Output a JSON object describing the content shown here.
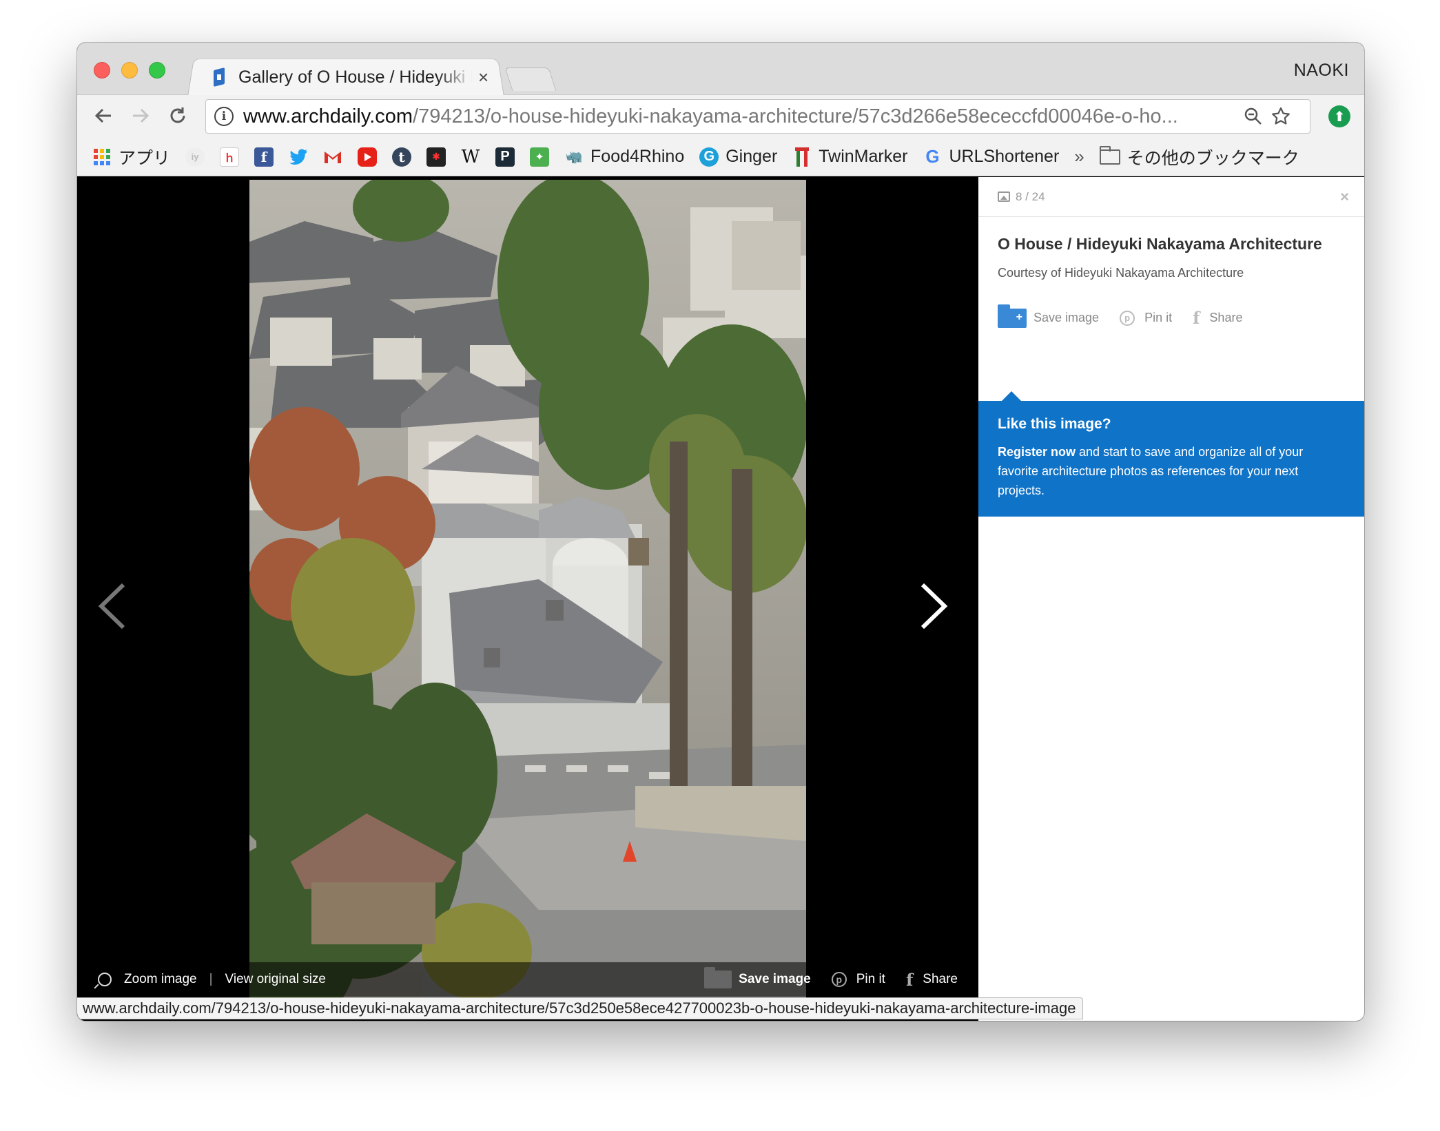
{
  "browser": {
    "tab_title": "Gallery of O House / Hideyuki Nakayama Architecture",
    "tab_close": "×",
    "profile_name": "NAOKI",
    "url_host": "www.archdaily.com",
    "url_path": "/794213/o-house-hideyuki-nakayama-architecture/57c3d266e58ececcfd00046e-o-ho...",
    "status_url": "www.archdaily.com/794213/o-house-hideyuki-nakayama-architecture/57c3d250e58ece427700023b-o-house-hideyuki-nakayama-architecture-image"
  },
  "bookmarks": {
    "apps_label": "アプリ",
    "items": [
      {
        "label": "Food4Rhino"
      },
      {
        "label": "Ginger"
      },
      {
        "label": "TwinMarker"
      },
      {
        "label": "URLShortener"
      }
    ],
    "more_label": "»",
    "other_label": "その他のブックマーク"
  },
  "viewer": {
    "zoom_label": "Zoom image",
    "separator": "|",
    "original_size_label": "View original size",
    "save_label": "Save image",
    "pin_label": "Pin it",
    "share_label": "Share"
  },
  "panel": {
    "counter": "8 / 24",
    "close": "×",
    "title": "O House / Hideyuki Nakayama Architecture",
    "credit": "Courtesy of Hideyuki Nakayama Architecture",
    "save_label": "Save image",
    "pin_label": "Pin it",
    "share_label": "Share",
    "promo_title": "Like this image?",
    "promo_register": "Register now",
    "promo_body": " and start to save and organize all of your favorite architecture photos as references for your next projects."
  },
  "colors": {
    "accent_blue": "#0f73c8",
    "save_folder_blue": "#3a89d6",
    "viewer_background": "#000000"
  }
}
